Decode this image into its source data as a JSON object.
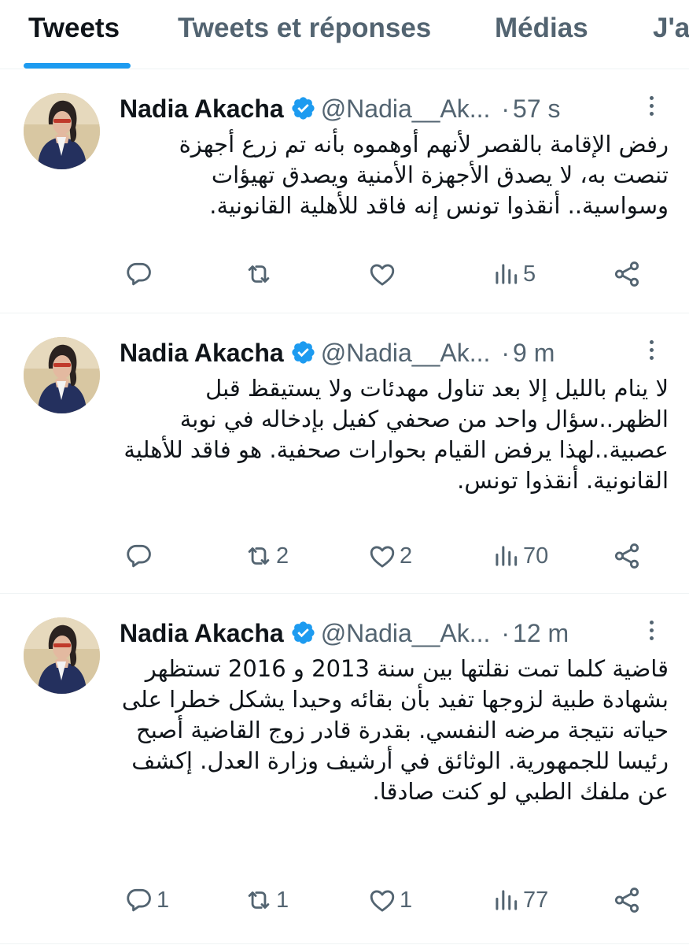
{
  "tabs": [
    {
      "label": "Tweets",
      "active": true
    },
    {
      "label": "Tweets et réponses",
      "active": false
    },
    {
      "label": "Médias",
      "active": false
    },
    {
      "label": "J'a",
      "active": false
    }
  ],
  "colors": {
    "accent": "#1d9bf0",
    "secondary_text": "#536471",
    "primary_text": "#0f1419",
    "divider": "#eff3f4"
  },
  "tweets": [
    {
      "author": "Nadia Akacha",
      "handle": "@Nadia__Ak...",
      "verified": true,
      "time": "57 s",
      "text": "رفض الإقامة بالقصر لأنهم أوهموه بأنه تم زرع أجهزة تنصت به، لا يصدق الأجهزة الأمنية ويصدق تهيؤات وسواسية.. أنقذوا تونس إنه فاقد للأهلية القانونية.",
      "replies": "",
      "retweets": "",
      "likes": "",
      "views": "5"
    },
    {
      "author": "Nadia Akacha",
      "handle": "@Nadia__Ak...",
      "verified": true,
      "time": "9 m",
      "text": "لا ينام بالليل إلا بعد تناول مهدئات ولا يستيقظ قبل الظهر..سؤال واحد من  صحفي كفيل بإدخاله في نوبة عصبية..لهذا يرفض القيام بحوارات صحفية. هو فاقد للأهلية القانونية. أنقذوا تونس.",
      "replies": "",
      "retweets": "2",
      "likes": "2",
      "views": "70"
    },
    {
      "author": "Nadia Akacha",
      "handle": "@Nadia__Ak...",
      "verified": true,
      "time": "12 m",
      "text": "قاضية كلما تمت نقلتها بين سنة 2013 و 2016 تستظهر بشهادة طبية لزوجها تفيد بأن بقائه وحيدا يشكل خطرا على حياته نتيجة مرضه النفسي. بقدرة قادر زوج القاضية أصبح رئيسا للجمهورية. الوثائق في أرشيف وزارة العدل. إكشف عن ملفك الطبي لو كنت صادقا.",
      "replies": "1",
      "retweets": "1",
      "likes": "1",
      "views": "77"
    }
  ],
  "icons": {
    "verified": "verified-badge-icon",
    "more": "more-vertical-icon",
    "reply": "reply-icon",
    "retweet": "retweet-icon",
    "like": "heart-icon",
    "views": "views-chart-icon",
    "share": "share-icon"
  }
}
